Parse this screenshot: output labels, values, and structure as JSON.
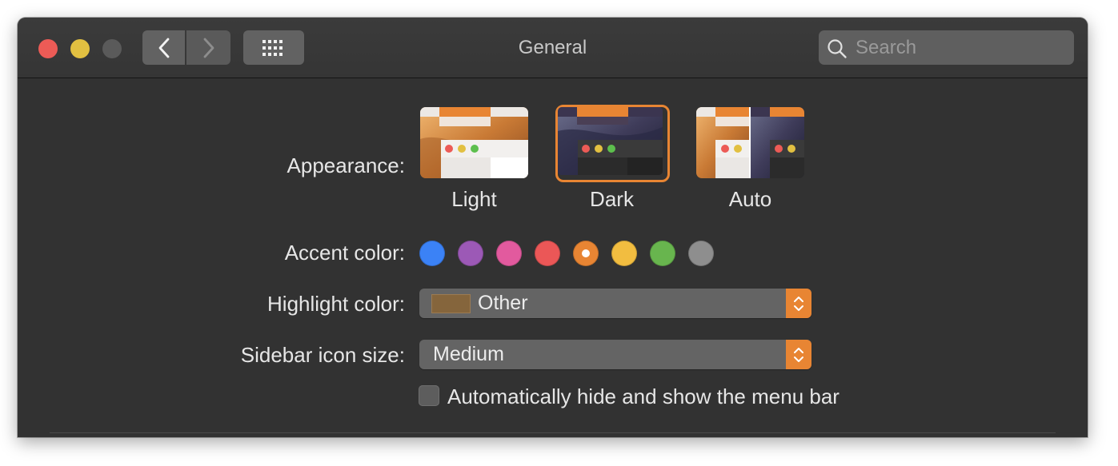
{
  "window": {
    "title": "General",
    "search_placeholder": "Search"
  },
  "icons": {
    "back": "chevron-left-icon",
    "forward": "chevron-right-icon",
    "show_all": "grid-icon",
    "search": "magnifier-icon",
    "stepper": "up-down-chevron-icon"
  },
  "appearance": {
    "label": "Appearance:",
    "options": [
      {
        "name": "Light",
        "selected": false
      },
      {
        "name": "Dark",
        "selected": true
      },
      {
        "name": "Auto",
        "selected": false
      }
    ]
  },
  "accent": {
    "label": "Accent color:",
    "colors": [
      "#3b82f6",
      "#9c59b6",
      "#e25a9e",
      "#eb5757",
      "#e88533",
      "#f2bd40",
      "#68b54e",
      "#8e8e8e"
    ],
    "selected_index": 4
  },
  "highlight": {
    "label": "Highlight color:",
    "value": "Other",
    "swatch_color": "#85653c"
  },
  "sidebar": {
    "label": "Sidebar icon size:",
    "value": "Medium"
  },
  "menubar": {
    "label": "Automatically hide and show the menu bar",
    "checked": false
  },
  "colors": {
    "accent": "#e88533",
    "window_bg": "#323232"
  }
}
